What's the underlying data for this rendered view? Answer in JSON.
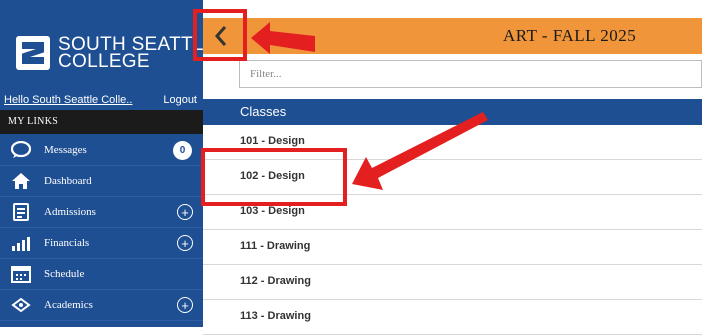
{
  "sidebar": {
    "logo": {
      "line1": "SOUTH SEATTLE",
      "line2": "COLLEGE"
    },
    "hello_text": "Hello South Seattle Colle..",
    "logout_label": "Logout",
    "mylinks_label": "MY LINKS",
    "items": [
      {
        "label": "Messages",
        "icon": "chat-icon",
        "badge": "0"
      },
      {
        "label": "Dashboard",
        "icon": "home-icon"
      },
      {
        "label": "Admissions",
        "icon": "admissions-icon",
        "expand": "+"
      },
      {
        "label": "Financials",
        "icon": "chart-icon",
        "expand": "+"
      },
      {
        "label": "Schedule",
        "icon": "calendar-icon"
      },
      {
        "label": "Academics",
        "icon": "academics-icon",
        "expand": "+"
      }
    ]
  },
  "header": {
    "back_icon": "chevron-left-icon",
    "title": "ART -  FALL 2025"
  },
  "filter": {
    "placeholder": "Filter..."
  },
  "classes": {
    "header": "Classes",
    "rows": [
      "101 - Design",
      "102 - Design",
      "103 - Design",
      "111 - Drawing",
      "112 - Drawing",
      "113 - Drawing"
    ]
  },
  "colors": {
    "sidebar": "#1f4f93",
    "header": "#f0953a",
    "annotation": "#e41f1f"
  }
}
